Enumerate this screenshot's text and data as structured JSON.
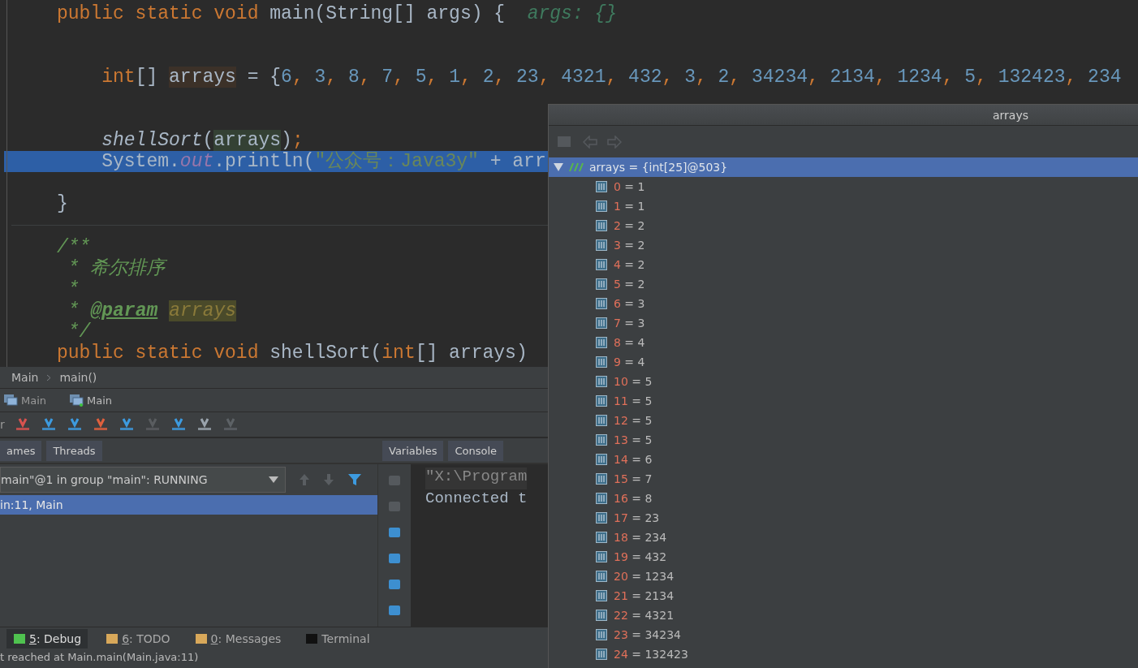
{
  "editor": {
    "lines": [
      {
        "kind": "code",
        "current": false,
        "tokens": [
          {
            "kind": "kw",
            "text": "public static void "
          },
          {
            "kind": "plain",
            "text": "main(String[] args) {  "
          },
          {
            "kind": "hint",
            "text": "args: {}"
          }
        ]
      },
      {
        "kind": "blank"
      },
      {
        "kind": "blank"
      },
      {
        "kind": "code",
        "current": false,
        "tokens": [
          {
            "kind": "kw",
            "text": "    int"
          },
          {
            "kind": "plain",
            "text": "[] "
          },
          {
            "kind": "decl",
            "text": "arrays"
          },
          {
            "kind": "plain",
            "text": " = {"
          },
          {
            "kind": "num",
            "text": "6"
          },
          {
            "kind": "kw",
            "text": ", "
          },
          {
            "kind": "num",
            "text": "3"
          },
          {
            "kind": "kw",
            "text": ", "
          },
          {
            "kind": "num",
            "text": "8"
          },
          {
            "kind": "kw",
            "text": ", "
          },
          {
            "kind": "num",
            "text": "7"
          },
          {
            "kind": "kw",
            "text": ", "
          },
          {
            "kind": "num",
            "text": "5"
          },
          {
            "kind": "kw",
            "text": ", "
          },
          {
            "kind": "num",
            "text": "1"
          },
          {
            "kind": "kw",
            "text": ", "
          },
          {
            "kind": "num",
            "text": "2"
          },
          {
            "kind": "kw",
            "text": ", "
          },
          {
            "kind": "num",
            "text": "23"
          },
          {
            "kind": "kw",
            "text": ", "
          },
          {
            "kind": "num",
            "text": "4321"
          },
          {
            "kind": "kw",
            "text": ", "
          },
          {
            "kind": "num",
            "text": "432"
          },
          {
            "kind": "kw",
            "text": ", "
          },
          {
            "kind": "num",
            "text": "3"
          },
          {
            "kind": "kw",
            "text": ", "
          },
          {
            "kind": "num",
            "text": "2"
          },
          {
            "kind": "kw",
            "text": ", "
          },
          {
            "kind": "num",
            "text": "34234"
          },
          {
            "kind": "kw",
            "text": ", "
          },
          {
            "kind": "num",
            "text": "2134"
          },
          {
            "kind": "kw",
            "text": ", "
          },
          {
            "kind": "num",
            "text": "1234"
          },
          {
            "kind": "kw",
            "text": ", "
          },
          {
            "kind": "num",
            "text": "5"
          },
          {
            "kind": "kw",
            "text": ", "
          },
          {
            "kind": "num",
            "text": "132423"
          },
          {
            "kind": "kw",
            "text": ", "
          },
          {
            "kind": "num",
            "text": "234"
          }
        ]
      },
      {
        "kind": "blank"
      },
      {
        "kind": "blank"
      },
      {
        "kind": "code",
        "current": false,
        "tokens": [
          {
            "kind": "fn",
            "text": "    shellSort"
          },
          {
            "kind": "plain",
            "text": "("
          },
          {
            "kind": "use",
            "text": "arrays"
          },
          {
            "kind": "plain",
            "text": ")"
          },
          {
            "kind": "kw",
            "text": ";"
          }
        ]
      },
      {
        "kind": "code",
        "current": true,
        "tokens": [
          {
            "kind": "plain",
            "text": "    System."
          },
          {
            "kind": "field",
            "text": "out"
          },
          {
            "kind": "plain",
            "text": ".println("
          },
          {
            "kind": "str",
            "text": "\"公众号：Java3y\""
          },
          {
            "kind": "plain",
            "text": " + arr"
          }
        ]
      },
      {
        "kind": "blank"
      },
      {
        "kind": "code",
        "current": false,
        "tokens": [
          {
            "kind": "plain",
            "text": "}"
          }
        ]
      },
      {
        "kind": "divider"
      },
      {
        "kind": "code",
        "current": false,
        "tokens": [
          {
            "kind": "doc",
            "text": "/**"
          }
        ]
      },
      {
        "kind": "code",
        "current": false,
        "tokens": [
          {
            "kind": "doc",
            "text": " * 希尔排序"
          }
        ]
      },
      {
        "kind": "code",
        "current": false,
        "tokens": [
          {
            "kind": "doc",
            "text": " *"
          }
        ]
      },
      {
        "kind": "code",
        "current": false,
        "tokens": [
          {
            "kind": "doc",
            "text": " * "
          },
          {
            "kind": "tag",
            "text": "@param"
          },
          {
            "kind": "ref",
            "text": "arrays"
          }
        ]
      },
      {
        "kind": "code",
        "current": false,
        "tokens": [
          {
            "kind": "doc",
            "text": " */"
          }
        ]
      },
      {
        "kind": "code",
        "current": false,
        "tokens": [
          {
            "kind": "kw",
            "text": "public static void "
          },
          {
            "kind": "plain",
            "text": "shellSort("
          },
          {
            "kind": "kw",
            "text": "int"
          },
          {
            "kind": "plain",
            "text": "[] arrays)"
          }
        ]
      }
    ]
  },
  "breadcrumb": [
    "Main",
    "main()"
  ],
  "run_tabs": [
    {
      "label": "Main",
      "selected": false
    },
    {
      "label": "Main",
      "selected": true
    }
  ],
  "toolbar": {
    "cut_label": "r"
  },
  "panel_tabs_left": [
    "ames",
    "Threads"
  ],
  "panel_tabs_right": [
    "Variables",
    "Console"
  ],
  "thread_selector": {
    "value": "main\"@1 in group \"main\": RUNNING"
  },
  "frames": [
    {
      "label": "in:11, Main",
      "selected": true
    }
  ],
  "console": {
    "lines": [
      "\"X:\\Program",
      "Connected t"
    ]
  },
  "tool_tabs": [
    {
      "key": "5",
      "label": ": Debug",
      "selected": true
    },
    {
      "key": "6",
      "label": ": TODO",
      "selected": false
    },
    {
      "key": "0",
      "label": ": Messages",
      "selected": false
    },
    {
      "label": "Terminal",
      "selected": false
    }
  ],
  "status_bar": "t reached at Main.main(Main.java:11)",
  "popup": {
    "title": "arrays",
    "root": {
      "label": "arrays = {int[25]@503}",
      "expanded": true,
      "selected": true,
      "children": [
        {
          "index": "0",
          "value": "= 1"
        },
        {
          "index": "1",
          "value": "= 1"
        },
        {
          "index": "2",
          "value": "= 2"
        },
        {
          "index": "3",
          "value": "= 2"
        },
        {
          "index": "4",
          "value": "= 2"
        },
        {
          "index": "5",
          "value": "= 2"
        },
        {
          "index": "6",
          "value": "= 3"
        },
        {
          "index": "7",
          "value": "= 3"
        },
        {
          "index": "8",
          "value": "= 4"
        },
        {
          "index": "9",
          "value": "= 4"
        },
        {
          "index": "10",
          "value": "= 5"
        },
        {
          "index": "11",
          "value": "= 5"
        },
        {
          "index": "12",
          "value": "= 5"
        },
        {
          "index": "13",
          "value": "= 5"
        },
        {
          "index": "14",
          "value": "= 6"
        },
        {
          "index": "15",
          "value": "= 7"
        },
        {
          "index": "16",
          "value": "= 8"
        },
        {
          "index": "17",
          "value": "= 23"
        },
        {
          "index": "18",
          "value": "= 234"
        },
        {
          "index": "19",
          "value": "= 432"
        },
        {
          "index": "20",
          "value": "= 1234"
        },
        {
          "index": "21",
          "value": "= 2134"
        },
        {
          "index": "22",
          "value": "= 4321"
        },
        {
          "index": "23",
          "value": "= 34234"
        },
        {
          "index": "24",
          "value": "= 132423"
        }
      ]
    }
  }
}
